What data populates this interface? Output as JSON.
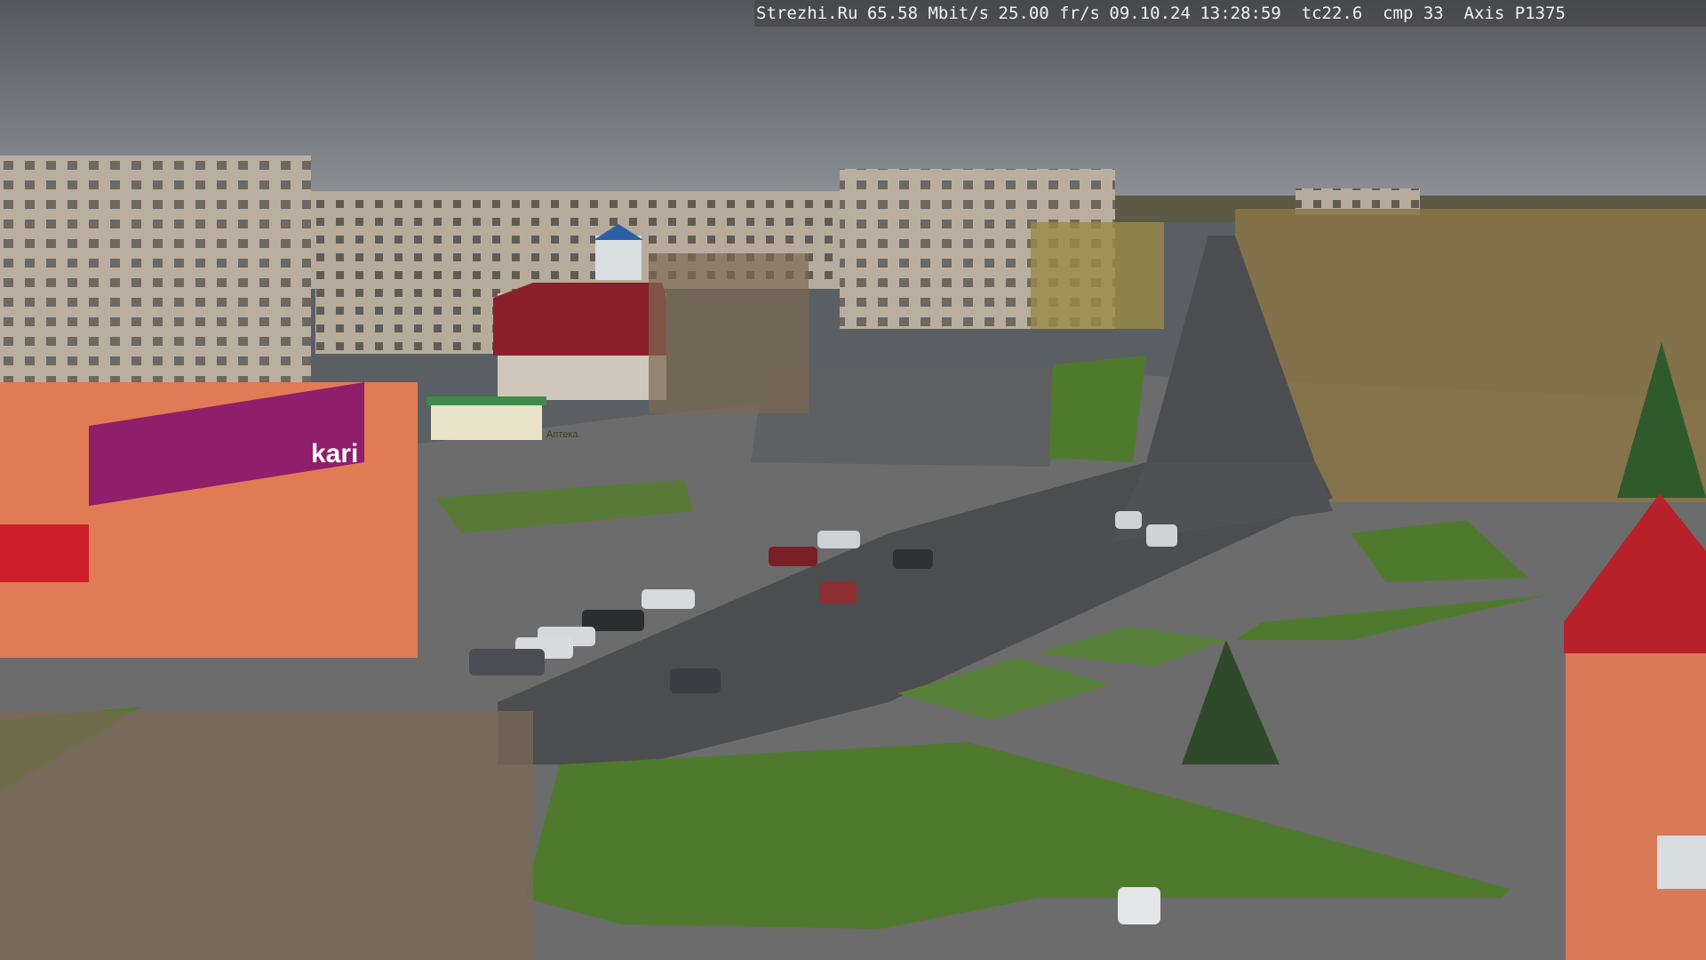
{
  "camera_overlay": {
    "site": "Strezhi.Ru",
    "bitrate": "65.58 Mbit/s",
    "framerate": "25.00 fr/s",
    "date": "09.10.24",
    "time": "13:28:59",
    "temperature": "tc22.6",
    "compression": "cmp 33",
    "camera_model": "Axis P1375"
  },
  "signage": {
    "store_sign": "kari",
    "pharmacy_sign": "Аптека"
  },
  "scene": {
    "sky_color": "#5f6468",
    "road_color": "#4b4d50",
    "grass_color": "#4f7a2e",
    "foliage_color": "#b28a3a"
  }
}
